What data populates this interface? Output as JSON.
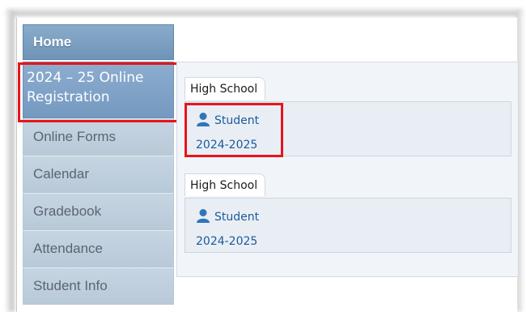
{
  "sidebar": {
    "items": [
      {
        "label": "Home"
      },
      {
        "label_line1": "2024 – 25 Online",
        "label_line2": "Registration"
      },
      {
        "label": "Online Forms"
      },
      {
        "label": "Calendar"
      },
      {
        "label": "Gradebook"
      },
      {
        "label": "Attendance"
      },
      {
        "label": "Student Info"
      }
    ]
  },
  "schools": [
    {
      "tab": "High School",
      "student_label": "Student",
      "year": "2024-2025",
      "icon": "person-icon"
    },
    {
      "tab": "High School",
      "student_label": "Student",
      "year": "2024-2025",
      "icon": "person-icon"
    }
  ],
  "colors": {
    "highlight": "#e8141b",
    "nav_active": "#7599c0",
    "link": "#1a5b9a"
  }
}
